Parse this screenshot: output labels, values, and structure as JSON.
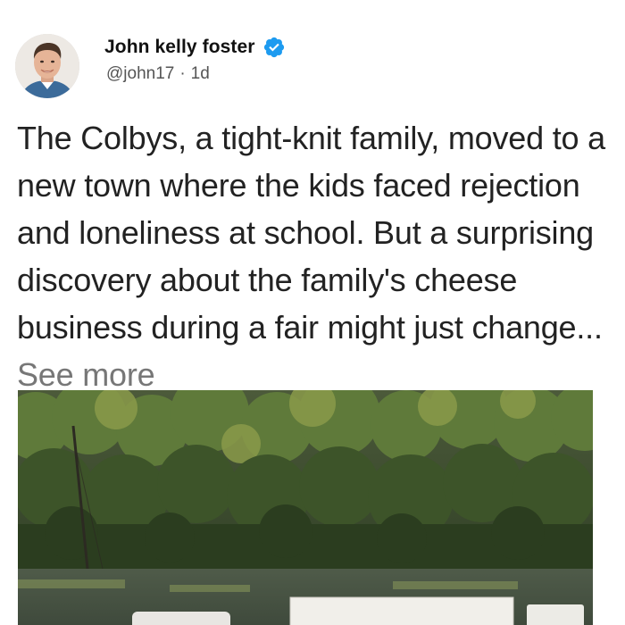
{
  "author": {
    "display_name": "John kelly foster",
    "handle": "@john17",
    "separator": "·",
    "time": "1d",
    "verified": true,
    "avatar_icon": "profile-photo"
  },
  "post": {
    "text": "The Colbys, a tight-knit family, moved to a new town where the kids faced rejection and loneliness at school. But a surprising discovery about the family's cheese business during a fair might just change... ",
    "see_more_label": "See more"
  },
  "media": {
    "icon": "photo-trees-and-trucks"
  },
  "colors": {
    "verified_badge": "#1d9bf0",
    "text": "#222222",
    "muted": "#777777"
  }
}
